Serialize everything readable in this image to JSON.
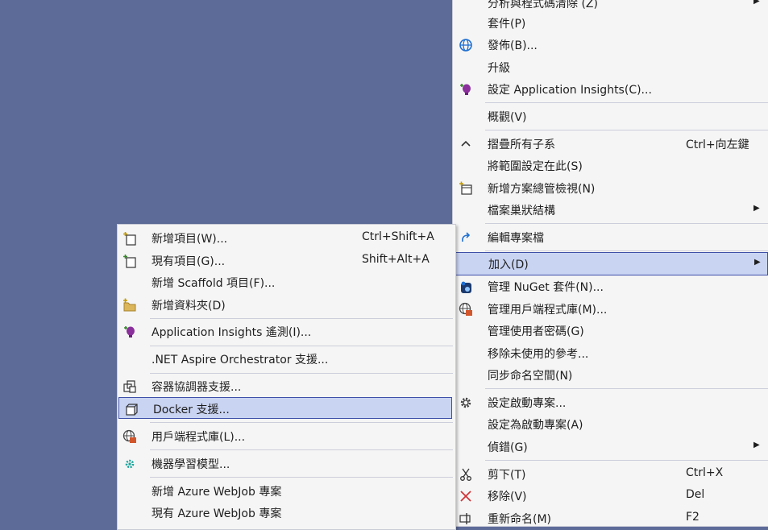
{
  "main_menu": {
    "items": [
      {
        "label": "分析與程式碼清除 (Z)",
        "arrow": "▶"
      },
      {
        "label": "套件(P)"
      },
      {
        "label": "發佈(B)...",
        "icon": "globe-icon"
      },
      {
        "label": "升級"
      },
      {
        "label": "設定 Application Insights(C)...",
        "icon": "application-insights-icon"
      },
      {
        "label": "概觀(V)"
      },
      {
        "label": "摺疊所有子系",
        "shortcut": "Ctrl+向左鍵",
        "icon": "chevron-up-icon"
      },
      {
        "label": "將範圍設定在此(S)"
      },
      {
        "label": "新增方案總管檢視(N)",
        "icon": "new-view-icon"
      },
      {
        "label": "檔案巢狀結構",
        "arrow": "▶"
      },
      {
        "label": "編輯專案檔",
        "icon": "redo-arrow-icon"
      },
      {
        "label": "加入(D)",
        "arrow": "▶"
      },
      {
        "label": "管理 NuGet 套件(N)...",
        "icon": "nuget-icon"
      },
      {
        "label": "管理用戶端程式庫(M)...",
        "icon": "client-library-icon"
      },
      {
        "label": "管理使用者密碼(G)"
      },
      {
        "label": "移除未使用的參考..."
      },
      {
        "label": "同步命名空間(N)"
      },
      {
        "label": "設定啟動專案...",
        "icon": "gear-icon"
      },
      {
        "label": "設定為啟動專案(A)"
      },
      {
        "label": "偵錯(G)",
        "arrow": "▶"
      },
      {
        "label": "剪下(T)",
        "shortcut": "Ctrl+X",
        "icon": "scissors-icon"
      },
      {
        "label": "移除(V)",
        "shortcut": "Del",
        "icon": "delete-x-icon"
      },
      {
        "label": "重新命名(M)",
        "shortcut": "F2",
        "icon": "rename-icon"
      }
    ]
  },
  "sub_menu": {
    "items": [
      {
        "label": "新增項目(W)...",
        "shortcut": "Ctrl+Shift+A",
        "icon": "new-item-icon"
      },
      {
        "label": "現有項目(G)...",
        "shortcut": "Shift+Alt+A",
        "icon": "existing-item-icon"
      },
      {
        "label": "新增 Scaffold 項目(F)..."
      },
      {
        "label": "新增資料夾(D)",
        "icon": "new-folder-icon"
      },
      {
        "label": "Application Insights 遙測(I)...",
        "icon": "application-insights-icon"
      },
      {
        "label": ".NET Aspire Orchestrator 支援..."
      },
      {
        "label": "容器協調器支援...",
        "icon": "container-orchestrator-icon"
      },
      {
        "label": "Docker 支援...",
        "icon": "docker-icon"
      },
      {
        "label": "用戶端程式庫(L)...",
        "icon": "client-library-icon"
      },
      {
        "label": "機器學習模型...",
        "icon": "machine-learning-icon"
      },
      {
        "label": "新增 Azure WebJob 專案"
      },
      {
        "label": "現有 Azure WebJob 專案"
      }
    ]
  }
}
